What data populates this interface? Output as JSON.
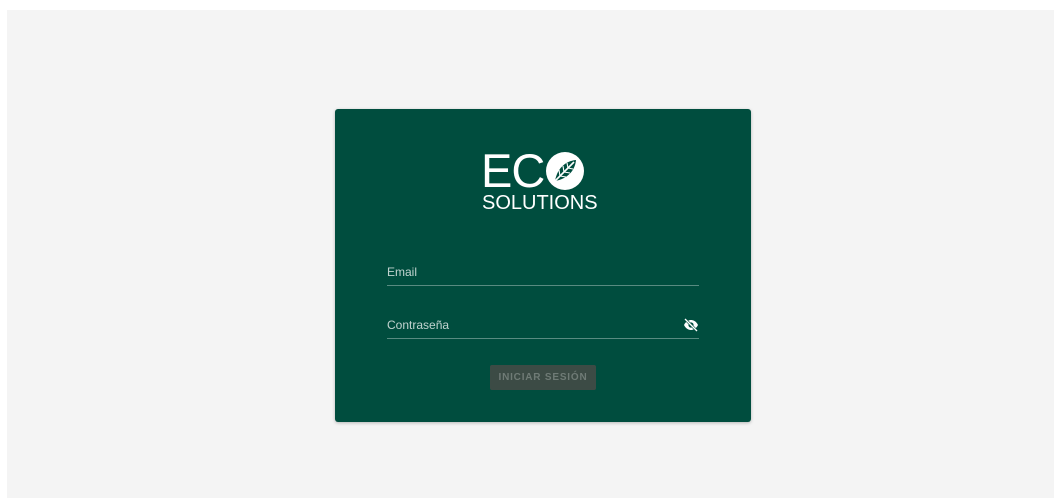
{
  "logo": {
    "main_text": "EC",
    "sub_text": "SOLUTIONS",
    "icon": "leaf-icon"
  },
  "form": {
    "email_placeholder": "Email",
    "email_value": "",
    "password_placeholder": "Contraseña",
    "password_value": "",
    "toggle_icon": "eye-off-icon",
    "submit_label": "INICIAR SESIÓN"
  },
  "colors": {
    "card_bg": "#004d3e",
    "page_bg": "#f4f4f4",
    "button_bg": "#3c4b45",
    "button_text": "#6f7b76"
  }
}
